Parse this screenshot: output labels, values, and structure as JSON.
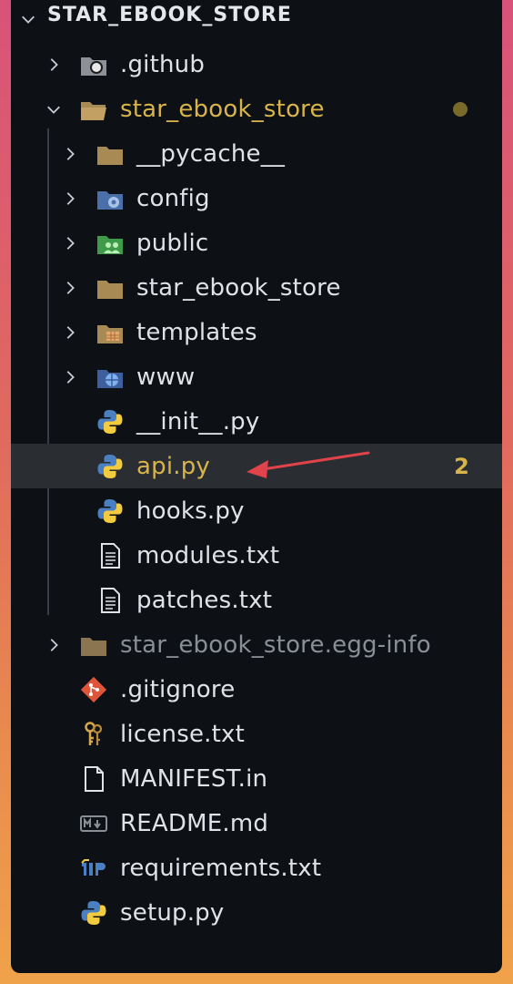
{
  "root": {
    "title": "STAR_EBOOK_STORE"
  },
  "tree": {
    "github": ".github",
    "pkg": "star_ebook_store",
    "pycache": "__pycache__",
    "config": "config",
    "public": "public",
    "inner_pkg": "star_ebook_store",
    "templates": "templates",
    "www": "www",
    "init": "__init__.py",
    "api": "api.py",
    "api_badge": "2",
    "hooks": "hooks.py",
    "modules": "modules.txt",
    "patches": "patches.txt",
    "egg": "star_ebook_store.egg-info",
    "gitignore": ".gitignore",
    "license": "license.txt",
    "manifest": "MANIFEST.in",
    "readme": "README.md",
    "requirements": "requirements.txt",
    "setup": "setup.py"
  },
  "colors": {
    "modified": "#d9b44a",
    "arrow": "#e0434a",
    "selection": "#2a2d31"
  }
}
